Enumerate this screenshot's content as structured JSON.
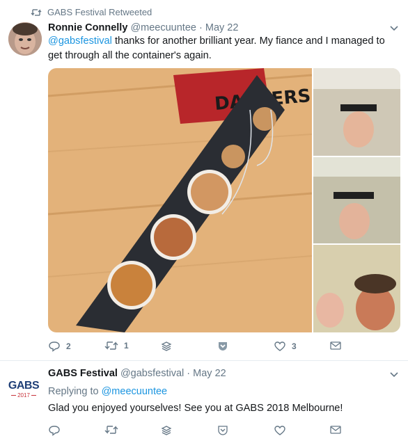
{
  "tweet1": {
    "retweet_label": "GABS Festival Retweeted",
    "author_name": "Ronnie Connelly",
    "author_handle": "@meecuuntee",
    "date": "May 22",
    "mention": "@gabsfestival",
    "text_rest": " thanks for another brilliant year. My fiance and I managed to get through all the container's again.",
    "actions": {
      "replies": "2",
      "retweets": "1",
      "likes": "3"
    }
  },
  "tweet2": {
    "author_name": "GABS Festival",
    "author_handle": "@gabsfestival",
    "date": "May 22",
    "replying_prefix": "Replying to",
    "replying_handle": "@meecuuntee",
    "text": "Glad you enjoyed yourselves! See you at GABS 2018 Melbourne!",
    "logo": {
      "word": "GABS",
      "year": "2017"
    }
  },
  "media_text": {
    "chalk": "DARKERS"
  },
  "colors": {
    "link": "#1b95e0",
    "muted": "#657786",
    "text": "#14171a",
    "border": "#e6ecf0"
  }
}
